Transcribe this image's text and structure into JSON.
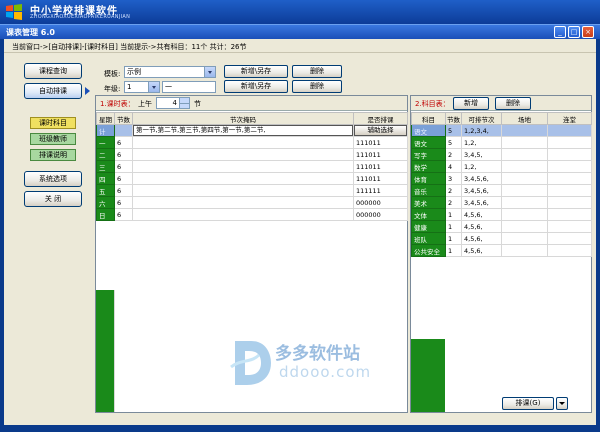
{
  "app": {
    "title": "中小学校排课软件",
    "subtitle": "ZHONGXIAOXUEXIAOPAIKERUANJIAN"
  },
  "window": {
    "title": "课表管理 6.0",
    "buttons": {
      "minimize": "_",
      "maximize": "□",
      "close": "×"
    }
  },
  "status": {
    "text": "当前窗口->[自动排课]-[课时科目]  当前提示->共有科目：11个   共计：26节"
  },
  "nav": {
    "course_query": "课程查询",
    "auto_schedule": "自动排课",
    "sub_items": [
      "课时科目",
      "班级教师",
      "排课说明"
    ],
    "system_options": "系统选项",
    "close": "关  闭"
  },
  "form": {
    "template_label": "模板:",
    "template_value": "示例",
    "save_new_label": "新增\\另存",
    "delete_label": "删除",
    "grade_label": "年级:",
    "grade_value": "1",
    "grade_name": "一",
    "save_new_label2": "新增\\另存",
    "delete_label2": "删除"
  },
  "left_panel": {
    "title": "1.课时表：",
    "period_label": "上午",
    "period_value": "4",
    "period_unit": "节",
    "columns": [
      "星期",
      "节数",
      "节次掩码",
      "是否排课"
    ],
    "edit_value": "第一节,第二节,第三节,第四节,第一节,第二节,",
    "aux_button": "辅助选择",
    "rows": [
      {
        "day": "计",
        "count": "",
        "mask": "",
        "flag": ""
      },
      {
        "day": "一",
        "count": "6",
        "mask": "",
        "flag": "111011"
      },
      {
        "day": "二",
        "count": "6",
        "mask": "",
        "flag": "111011"
      },
      {
        "day": "三",
        "count": "6",
        "mask": "",
        "flag": "111011"
      },
      {
        "day": "四",
        "count": "6",
        "mask": "",
        "flag": "111011"
      },
      {
        "day": "五",
        "count": "6",
        "mask": "",
        "flag": "111111"
      },
      {
        "day": "六",
        "count": "6",
        "mask": "",
        "flag": "000000"
      },
      {
        "day": "日",
        "count": "6",
        "mask": "",
        "flag": "000000"
      }
    ]
  },
  "right_panel": {
    "title": "2.科目表：",
    "add_label": "新增",
    "delete_label": "删除",
    "columns": [
      "科目",
      "节数",
      "可排节次",
      "场地",
      "连堂"
    ],
    "rows": [
      {
        "subject": "语文",
        "count": "5",
        "slots": "1,2,3,4,"
      },
      {
        "subject": "语文",
        "count": "5",
        "slots": "1,2,"
      },
      {
        "subject": "写字",
        "count": "2",
        "slots": "3,4,5,"
      },
      {
        "subject": "数学",
        "count": "4",
        "slots": "1,2,"
      },
      {
        "subject": "体育",
        "count": "3",
        "slots": "3,4,5,6,"
      },
      {
        "subject": "音乐",
        "count": "2",
        "slots": "3,4,5,6,"
      },
      {
        "subject": "美术",
        "count": "2",
        "slots": "3,4,5,6,"
      },
      {
        "subject": "文体",
        "count": "1",
        "slots": "4,5,6,"
      },
      {
        "subject": "健康",
        "count": "1",
        "slots": "4,5,6,"
      },
      {
        "subject": "班队",
        "count": "1",
        "slots": "4,5,6,"
      },
      {
        "subject": "公共安全",
        "count": "1",
        "slots": "4,5,6,"
      }
    ]
  },
  "footer": {
    "schedule_label": "排课(G)"
  },
  "watermark": {
    "cn": "多多软件站",
    "en": "ddooo.com"
  }
}
